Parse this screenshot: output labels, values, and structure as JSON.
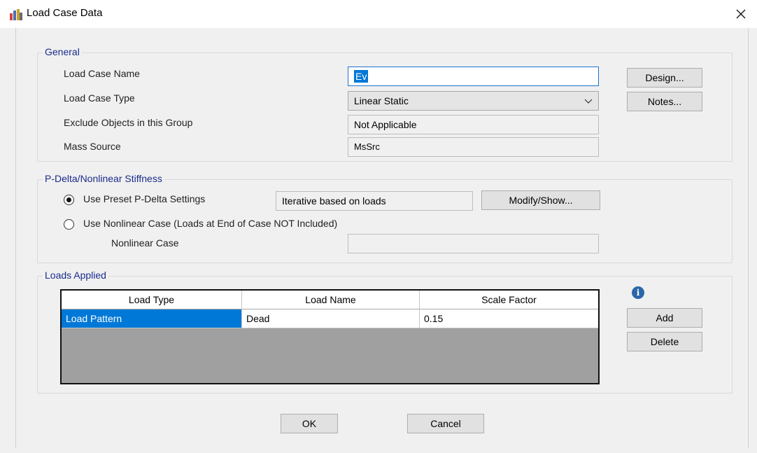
{
  "window": {
    "title": "Load Case Data"
  },
  "general": {
    "group_label": "General",
    "load_case_name_label": "Load Case Name",
    "load_case_name_value": "Ev",
    "load_case_type_label": "Load Case Type",
    "load_case_type_value": "Linear Static",
    "exclude_objects_label": "Exclude Objects in this Group",
    "exclude_objects_value": "Not Applicable",
    "mass_source_label": "Mass Source",
    "mass_source_value": "MsSrc",
    "design_button": "Design...",
    "notes_button": "Notes..."
  },
  "pdelta": {
    "group_label": "P-Delta/Nonlinear Stiffness",
    "preset_label": "Use Preset P-Delta Settings",
    "preset_value": "Iterative based on loads",
    "preset_selected": true,
    "modify_button": "Modify/Show...",
    "nonlinear_label": "Use Nonlinear Case  (Loads at End of Case NOT Included)",
    "nonlinear_case_label": "Nonlinear Case",
    "nonlinear_case_value": ""
  },
  "loads": {
    "group_label": "Loads Applied",
    "columns": [
      "Load Type",
      "Load Name",
      "Scale Factor"
    ],
    "rows": [
      {
        "load_type": "Load Pattern",
        "load_name": "Dead",
        "scale_factor": "0.15"
      }
    ],
    "add_button": "Add",
    "delete_button": "Delete",
    "info_icon": "info-icon"
  },
  "footer": {
    "ok_button": "OK",
    "cancel_button": "Cancel"
  }
}
